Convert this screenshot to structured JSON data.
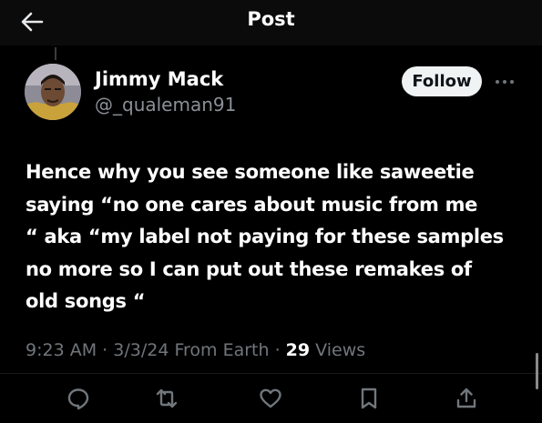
{
  "header": {
    "title": "Post",
    "back_icon": "arrow-left-icon"
  },
  "author": {
    "display_name": "Jimmy Mack",
    "handle": "@_qualeman91",
    "follow_label": "Follow",
    "more_icon": "more-horizontal-icon"
  },
  "post": {
    "lines": [
      "Hence why you see someone like saweetie",
      "saying “no one cares about music from me",
      "“ aka “my label not paying for these samples",
      "no more so I can put out these remakes of",
      "old songs “"
    ],
    "time": "9:23 AM",
    "date": "3/3/24",
    "source": "From Earth",
    "separator": "·",
    "views_count": "29",
    "views_label": "Views"
  },
  "actions": [
    {
      "name": "reply",
      "icon": "reply-icon"
    },
    {
      "name": "repost",
      "icon": "repost-icon"
    },
    {
      "name": "like",
      "icon": "heart-icon"
    },
    {
      "name": "bookmark",
      "icon": "bookmark-icon"
    },
    {
      "name": "share",
      "icon": "share-icon"
    }
  ],
  "colors": {
    "background": "#000000",
    "header_background": "#0b0b0c",
    "text_primary": "#ffffff",
    "text_secondary": "#71767b",
    "follow_button": "#eff3f4"
  }
}
